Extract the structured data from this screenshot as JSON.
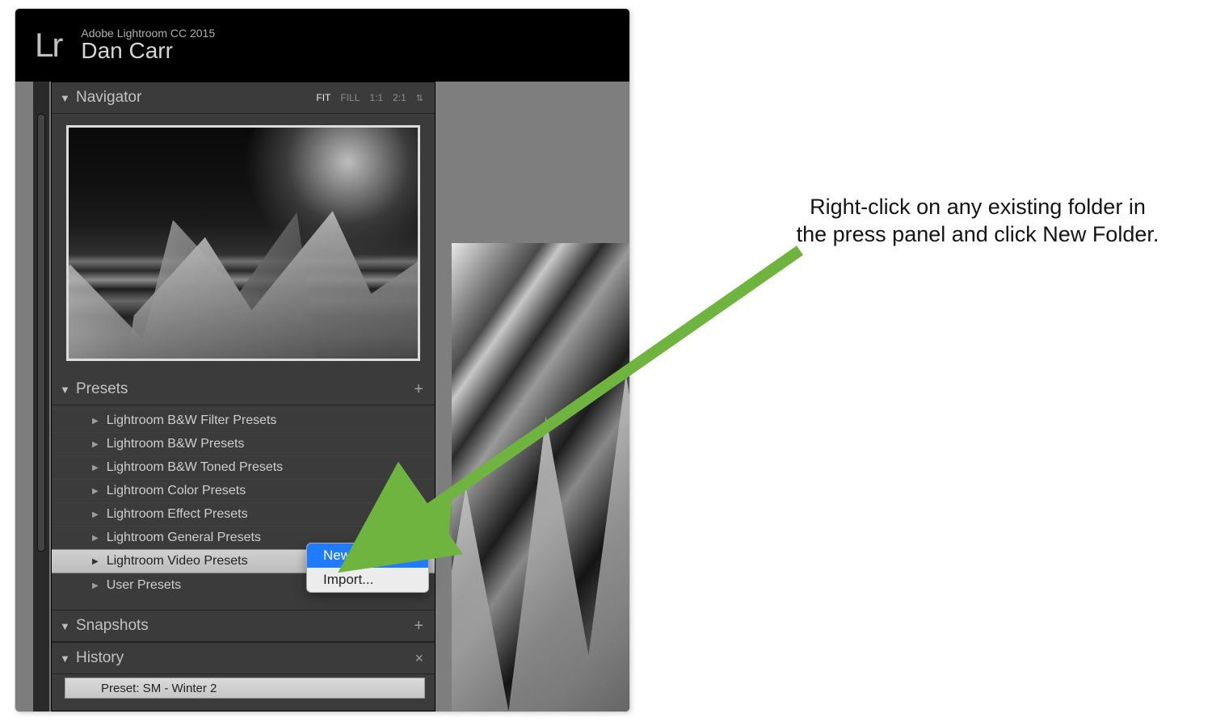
{
  "app": {
    "logo": "Lr",
    "title_small": "Adobe Lightroom CC 2015",
    "title_big": "Dan Carr"
  },
  "navigator": {
    "label": "Navigator",
    "controls": {
      "fit": "FIT",
      "fill": "FILL",
      "one_to_one": "1:1",
      "two_to_one": "2:1"
    }
  },
  "presets": {
    "label": "Presets",
    "items": [
      {
        "name": "Lightroom B&W Filter Presets",
        "selected": false
      },
      {
        "name": "Lightroom B&W Presets",
        "selected": false
      },
      {
        "name": "Lightroom B&W Toned Presets",
        "selected": false
      },
      {
        "name": "Lightroom Color Presets",
        "selected": false
      },
      {
        "name": "Lightroom Effect Presets",
        "selected": false
      },
      {
        "name": "Lightroom General Presets",
        "selected": false
      },
      {
        "name": "Lightroom Video Presets",
        "selected": true
      },
      {
        "name": "User Presets",
        "selected": false
      }
    ]
  },
  "snapshots": {
    "label": "Snapshots"
  },
  "history": {
    "label": "History",
    "items": [
      "Preset: SM - Winter 2"
    ]
  },
  "context_menu": {
    "items": [
      {
        "label": "New Folder",
        "selected": true
      },
      {
        "label": "Import...",
        "selected": false
      }
    ]
  },
  "annotation": {
    "text": "Right-click on any existing folder in the press panel and click New Folder."
  },
  "colors": {
    "arrow": "#6fb43f",
    "menu_highlight": "#1f7bff"
  },
  "symbols": {
    "tri_down": "▼",
    "tri_right": "▶",
    "plus": "+",
    "close": "×",
    "updown": "⇅"
  }
}
